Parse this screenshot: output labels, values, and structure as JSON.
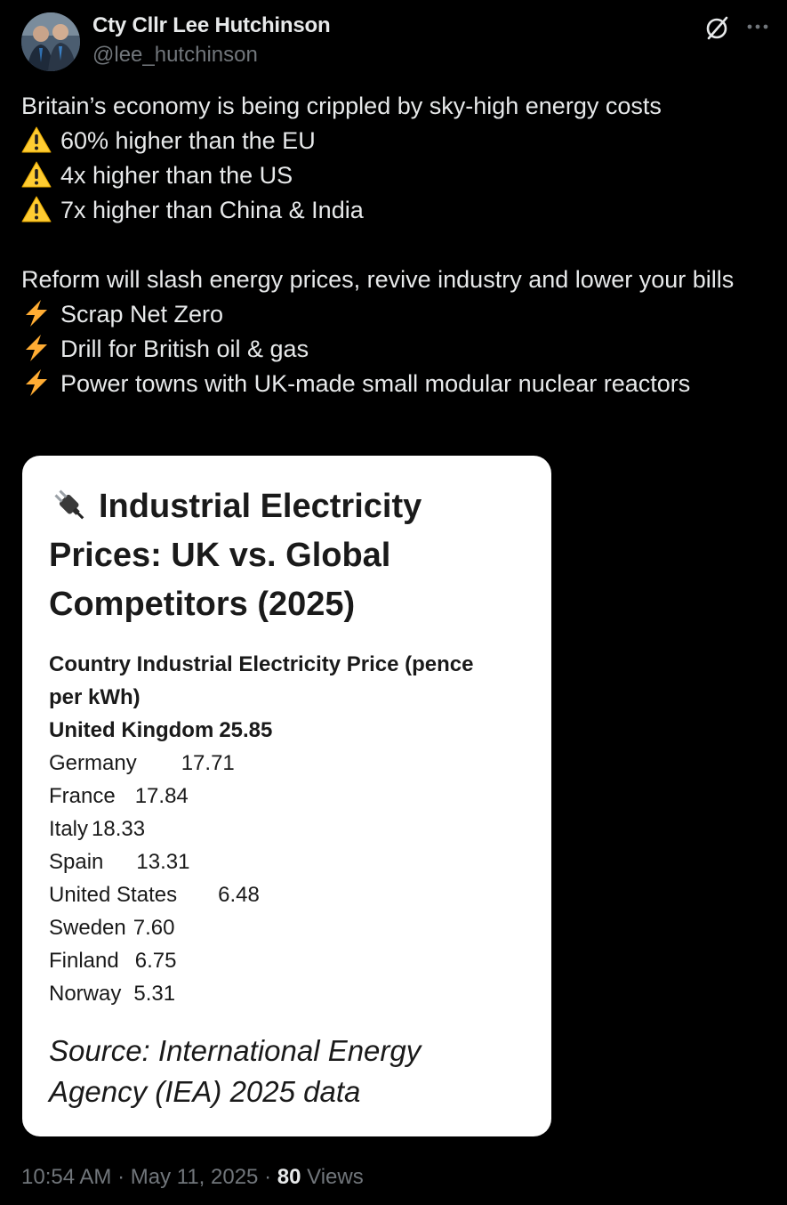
{
  "author": {
    "display_name": "Cty Cllr Lee Hutchinson",
    "handle": "@lee_hutchinson"
  },
  "icons": {
    "avatar": "profile-photo",
    "grok": "grok-icon",
    "more": "more-options-icon",
    "warning": "warning-sign-emoji",
    "bolt": "high-voltage-emoji",
    "plug": "electric-plug-emoji"
  },
  "tweet": {
    "intro": "Britain’s economy is being crippled by sky-high energy costs",
    "warnings": [
      "60% higher than the EU",
      "4x higher than the US",
      "7x higher than China & India"
    ],
    "pledge": "Reform will slash energy prices, revive industry and lower your bills",
    "actions": [
      "Scrap Net Zero",
      "Drill for British oil & gas",
      "Power towns with UK-made small modular nuclear reactors"
    ]
  },
  "media": {
    "title_lines": [
      "Industrial Electricity",
      "Prices: UK vs. Global",
      "Competitors (2025)"
    ],
    "header_country": "Country",
    "header_price": "Industrial Electricity Price (pence",
    "header_price_cont": "per kWh)",
    "rows": [
      {
        "country": "United Kingdom",
        "price": "25.85"
      },
      {
        "country": "Germany",
        "price": "17.71"
      },
      {
        "country": "France",
        "price": "17.84"
      },
      {
        "country": "Italy",
        "price": "18.33"
      },
      {
        "country": "Spain",
        "price": "13.31"
      },
      {
        "country": "United States",
        "price": "6.48"
      },
      {
        "country": "Sweden",
        "price": "7.60"
      },
      {
        "country": "Finland",
        "price": "6.75"
      },
      {
        "country": "Norway",
        "price": "5.31"
      }
    ],
    "source_lines": [
      "Source: International Energy",
      "Agency (IEA) 2025 data"
    ]
  },
  "footer": {
    "time": "10:54 AM",
    "separator": "·",
    "date": "May 11, 2025",
    "views_count": "80",
    "views_label": "Views"
  },
  "colors": {
    "background": "#000000",
    "primary_text": "#e7e9ea",
    "secondary_text": "#71767b",
    "card_background": "#ffffff",
    "warning_yellow": "#ffcc32",
    "bolt_yellow": "#ffac33"
  }
}
